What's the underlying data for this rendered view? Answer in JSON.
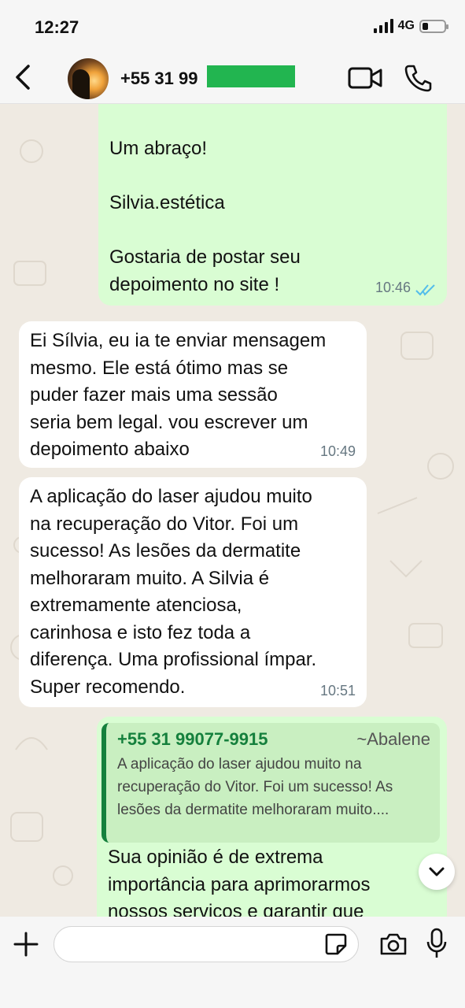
{
  "status_bar": {
    "time": "12:27",
    "network": "4G",
    "battery_level": 0.2
  },
  "header": {
    "contact_name": "+55 31 99",
    "icons": [
      "back-icon",
      "avatar",
      "video-call-icon",
      "phone-icon"
    ]
  },
  "messages": [
    {
      "direction": "outgoing",
      "lines": "Um abraço!\n\nSilvia.estética\n\nGostaria de postar seu\ndepoimento no site !",
      "time": "10:46",
      "read": true
    },
    {
      "direction": "incoming",
      "lines": "Ei Sílvia, eu ia te enviar mensagem\nmesmo. Ele está ótimo mas se\npuder fazer mais uma sessão\nseria bem legal. vou escrever um\ndepoimento abaixo",
      "time": "10:49"
    },
    {
      "direction": "incoming",
      "lines": "A aplicação do laser ajudou muito\nna recuperação do Vitor. Foi um\nsucesso! As lesões da dermatite\nmelhoraram muito. A Silvia é\nextremamente atenciosa,\ncarinhosa e isto fez toda a\ndiferença. Uma profissional ímpar.\nSuper recomendo.",
      "time": "10:51"
    },
    {
      "direction": "outgoing",
      "quote": {
        "phone": "+55 31 99077-9915",
        "name": "~Abalene",
        "text": "A aplicação do laser ajudou muito na\nrecuperação do Vitor. Foi um sucesso! As\nlesões da dermatite melhoraram muito...."
      },
      "lines": "Sua opinião é de extrema\nimportância para aprimorarmos\nnossos serviços e garantir que"
    }
  ],
  "composer": {
    "placeholder": ""
  },
  "colors": {
    "outgoing_bubble": "#d9fdd3",
    "incoming_bubble": "#ffffff",
    "accent_green": "#15803d",
    "read_tick": "#53bdeb"
  }
}
